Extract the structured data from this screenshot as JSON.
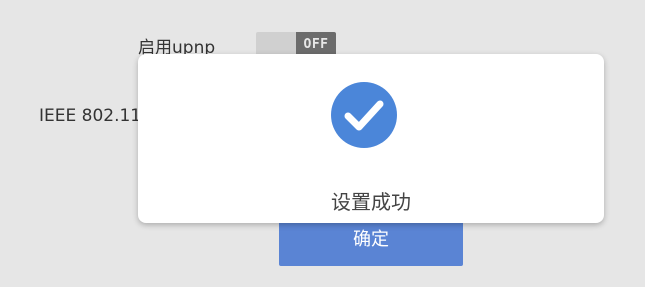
{
  "settings": {
    "upnp_label": "启用upnp",
    "upnp_toggle_state": "OFF",
    "ieee_label": "IEEE 802.11"
  },
  "actions": {
    "confirm_label": "确定"
  },
  "modal": {
    "icon": "check-circle-icon",
    "message": "设置成功"
  },
  "colors": {
    "background": "#e6e6e6",
    "accent": "#4b86d9",
    "button": "#5a84d4",
    "toggle_off": "#6c6c6c"
  }
}
